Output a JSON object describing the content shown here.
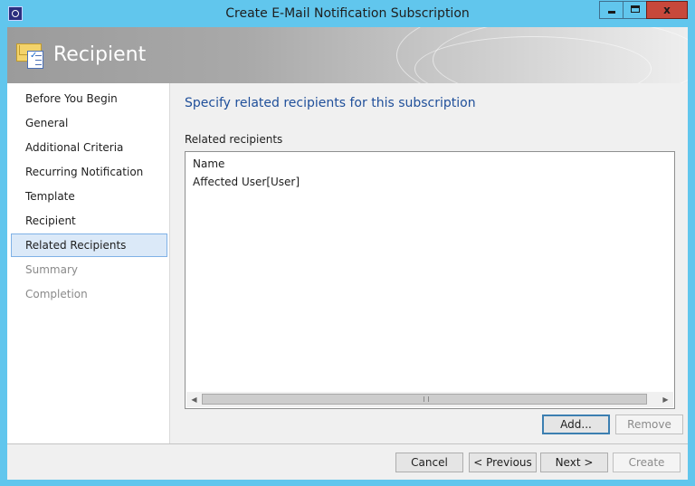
{
  "window": {
    "title": "Create E-Mail Notification Subscription",
    "close_glyph": "x"
  },
  "banner": {
    "title": "Recipient"
  },
  "nav": {
    "items": [
      {
        "label": "Before You Begin",
        "state": "normal"
      },
      {
        "label": "General",
        "state": "normal"
      },
      {
        "label": "Additional Criteria",
        "state": "normal"
      },
      {
        "label": "Recurring Notification",
        "state": "normal"
      },
      {
        "label": "Template",
        "state": "normal"
      },
      {
        "label": "Recipient",
        "state": "normal"
      },
      {
        "label": "Related Recipients",
        "state": "selected"
      },
      {
        "label": "Summary",
        "state": "disabled"
      },
      {
        "label": "Completion",
        "state": "disabled"
      }
    ]
  },
  "main": {
    "heading": "Specify related recipients for this subscription",
    "list_label": "Related recipients",
    "list": {
      "column_header": "Name",
      "rows": [
        "Affected User[User]"
      ]
    },
    "add_label": "Add...",
    "remove_label": "Remove"
  },
  "footer": {
    "cancel_label": "Cancel",
    "previous_label": "< Previous",
    "next_label": "Next >",
    "create_label": "Create"
  },
  "colors": {
    "title_bar": "#61c6ed",
    "heading": "#1f4f9a",
    "selection": "#dbe9f8",
    "close_button": "#c7483b"
  },
  "icons": [
    "app-icon",
    "minimize-icon",
    "maximize-icon",
    "close-icon",
    "subscription-icon",
    "scroll-left-icon",
    "scroll-right-icon"
  ]
}
